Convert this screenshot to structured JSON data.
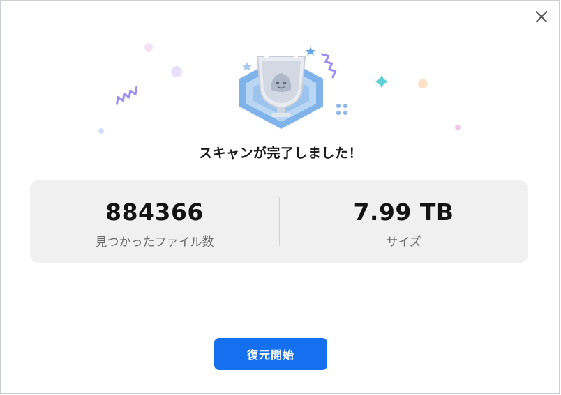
{
  "dialog": {
    "title": "スキャンが完了しました！",
    "close_icon": "close-icon"
  },
  "stats": {
    "files": {
      "value": "884366",
      "label": "見つかったファイル数"
    },
    "size": {
      "value": "7.99 TB",
      "label": "サイズ"
    }
  },
  "actions": {
    "primary_label": "復元開始"
  },
  "colors": {
    "accent": "#1570ef",
    "stats_background": "#f0f0f1",
    "confetti_purple": "#8b7cf0",
    "confetti_teal": "#5fd0d5",
    "trophy_blue": "#6ea6e6"
  }
}
